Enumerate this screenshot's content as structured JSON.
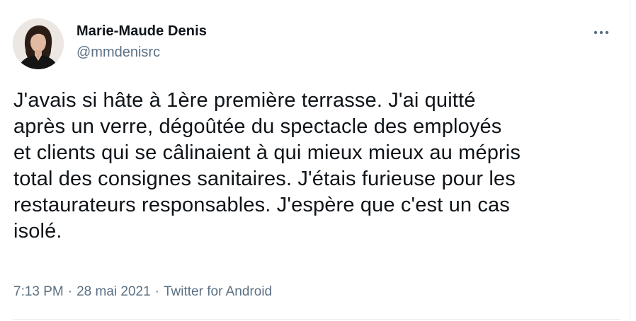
{
  "tweet": {
    "author": {
      "name": "Marie-Maude Denis",
      "handle": "@mmdenisrc",
      "avatar_icon": "profile-photo"
    },
    "more_icon": "more-options-icon",
    "text": "J'avais si hâte à 1ère première terrasse. J'ai quitté\naprès un verre, dégoûtée du spectacle des employés\net clients qui se câlinaient à qui mieux mieux au mépris\ntotal des consignes sanitaires. J'étais furieuse pour les\nrestaurateurs responsables. J'espère que c'est un cas\nisolé.",
    "meta": {
      "time": "7:13 PM",
      "separator": "·",
      "date": "28 mai 2021",
      "source": "Twitter for Android"
    }
  },
  "colors": {
    "text": "#0f1419",
    "secondary": "#5b7083",
    "border": "#e6ecf0"
  }
}
